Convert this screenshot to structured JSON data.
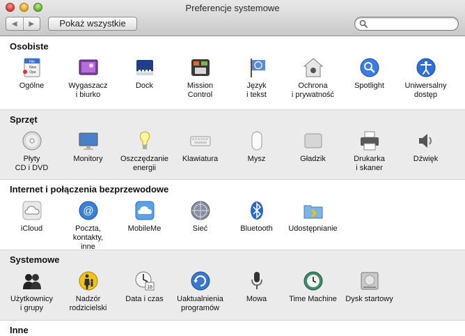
{
  "window": {
    "title": "Preferencje systemowe"
  },
  "toolbar": {
    "back_glyph": "◀",
    "forward_glyph": "▶",
    "show_all_label": "Pokaż wszystkie",
    "search_value": "",
    "search_placeholder": ""
  },
  "sections": [
    {
      "title": "Osobiste",
      "items": [
        {
          "label": "Ogólne",
          "icon": "general-icon"
        },
        {
          "label": "Wygaszacz\ni biurko",
          "icon": "desktop-screensaver-icon"
        },
        {
          "label": "Dock",
          "icon": "dock-icon"
        },
        {
          "label": "Mission\nControl",
          "icon": "mission-control-icon"
        },
        {
          "label": "Język\ni tekst",
          "icon": "language-text-icon"
        },
        {
          "label": "Ochrona\ni prywatność",
          "icon": "security-privacy-icon"
        },
        {
          "label": "Spotlight",
          "icon": "spotlight-icon"
        },
        {
          "label": "Uniwersalny\ndostęp",
          "icon": "universal-access-icon"
        }
      ]
    },
    {
      "title": "Sprzęt",
      "items": [
        {
          "label": "Płyty\nCD i DVD",
          "icon": "cd-dvd-icon"
        },
        {
          "label": "Monitory",
          "icon": "displays-icon"
        },
        {
          "label": "Oszczędzanie\nenergii",
          "icon": "energy-saver-icon"
        },
        {
          "label": "Klawiatura",
          "icon": "keyboard-icon"
        },
        {
          "label": "Mysz",
          "icon": "mouse-icon"
        },
        {
          "label": "Gładzik",
          "icon": "trackpad-icon"
        },
        {
          "label": "Drukarka\ni skaner",
          "icon": "printer-scanner-icon"
        },
        {
          "label": "Dźwięk",
          "icon": "sound-icon"
        }
      ]
    },
    {
      "title": "Internet i połączenia bezprzewodowe",
      "items": [
        {
          "label": "iCloud",
          "icon": "icloud-icon"
        },
        {
          "label": "Poczta, kontakty,\ninne",
          "icon": "mail-contacts-icon"
        },
        {
          "label": "MobileMe",
          "icon": "mobileme-icon"
        },
        {
          "label": "Sieć",
          "icon": "network-icon"
        },
        {
          "label": "Bluetooth",
          "icon": "bluetooth-icon"
        },
        {
          "label": "Udostępnianie",
          "icon": "sharing-icon"
        }
      ]
    },
    {
      "title": "Systemowe",
      "items": [
        {
          "label": "Użytkownicy\ni grupy",
          "icon": "users-groups-icon"
        },
        {
          "label": "Nadzór\nrodzicielski",
          "icon": "parental-controls-icon"
        },
        {
          "label": "Data i czas",
          "icon": "date-time-icon"
        },
        {
          "label": "Uaktualnienia\nprogramów",
          "icon": "software-update-icon"
        },
        {
          "label": "Mowa",
          "icon": "speech-icon"
        },
        {
          "label": "Time Machine",
          "icon": "time-machine-icon"
        },
        {
          "label": "Dysk startowy",
          "icon": "startup-disk-icon"
        }
      ]
    },
    {
      "title": "Inne",
      "items": []
    }
  ]
}
